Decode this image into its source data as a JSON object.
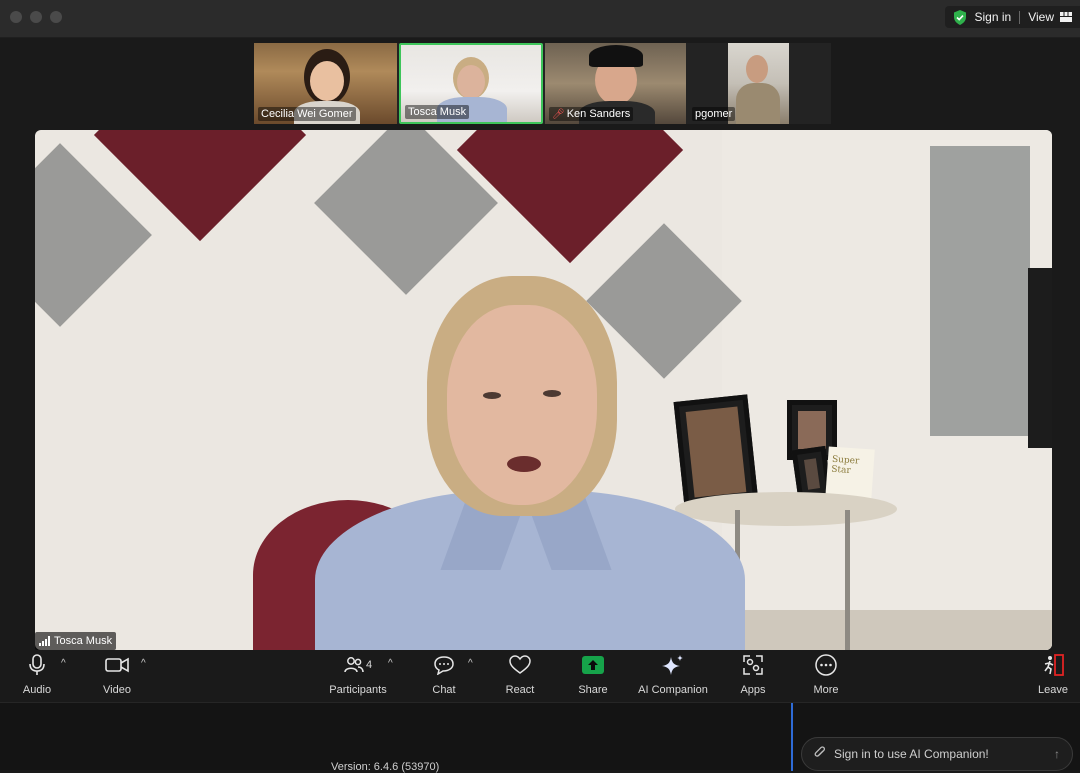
{
  "titlebar": {
    "sign_in": "Sign in",
    "view": "View"
  },
  "thumbnails": [
    {
      "name": "Cecilia Wei Gomer"
    },
    {
      "name": "Tosca Musk",
      "active": true
    },
    {
      "name": "Ken Sanders",
      "muted": true
    },
    {
      "name": "pgomer"
    }
  ],
  "main_video": {
    "speaker": "Tosca Musk",
    "card_text": "Super Star"
  },
  "toolbar": {
    "audio": "Audio",
    "video": "Video",
    "participants": "Participants",
    "participant_count": "4",
    "chat": "Chat",
    "react": "React",
    "share": "Share",
    "ai_companion": "AI Companion",
    "apps": "Apps",
    "more": "More",
    "leave": "Leave"
  },
  "footer": {
    "version": "Version: 6.4.6 (53970)",
    "ai_prompt": "Sign in to use AI Companion!"
  },
  "colors": {
    "active_border": "#3ec55a",
    "share_green": "#16a34a",
    "divider_blue": "#2e6bd6",
    "leave_red": "#e02424"
  }
}
